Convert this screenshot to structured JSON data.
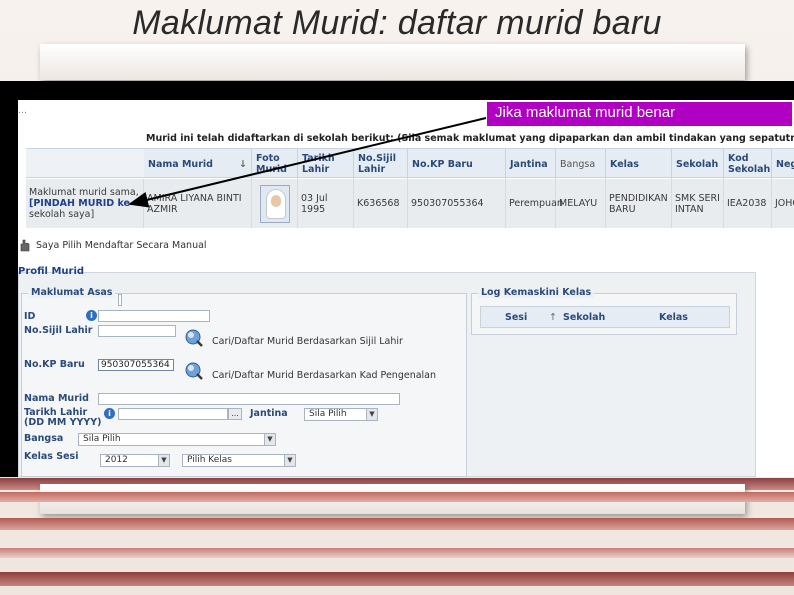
{
  "slide": {
    "title": "Maklumat Murid: daftar murid baru",
    "callout": "Jika maklumat murid benar"
  },
  "app": {
    "top_text": "…",
    "notice_lead": "Murid ini telah didaftarkan di sekolah berikut:",
    "notice_paren": "(Sila semak maklumat yang dipaparkan dan ambil tindakan yang sepatutnya)",
    "table": {
      "headers": [
        "Nama Murid",
        "Foto Murid",
        "Tarikh Lahir",
        "No.Sijil Lahir",
        "No.KP Baru",
        "Jantina",
        "Bangsa",
        "Kelas",
        "Sekolah",
        "Kod Sekolah",
        "Negeri"
      ],
      "row": {
        "note_prefix": "Maklumat murid sama,",
        "note_action": "[PINDAH MURID ke",
        "note_suffix": "sekolah saya]",
        "nama": "AMIRA LIYANA BINTI AZMIR",
        "tarikh_lahir": "03 Jul 1995",
        "sijil_lahir": "K636568",
        "kp_baru": "950307055364",
        "jantina": "Perempuan",
        "bangsa": "MELAYU",
        "kelas": "PENDIDIKAN BARU",
        "sekolah": "SMK SERI INTAN",
        "kod_sekolah": "IEA2038",
        "negeri": "JOHOR"
      }
    },
    "manual_label": "Saya Pilih Mendaftar Secara Manual",
    "profil_title": "Profil Murid",
    "maklumat_asas": {
      "legend": "Maklumat Asas",
      "id_label": "ID",
      "sijil_label": "No.Sijil Lahir",
      "kp_label": "No.KP Baru",
      "kp_value": "950307055364",
      "search_sijil": "Cari/Daftar Murid Berdasarkan Sijil Lahir",
      "search_kp": "Cari/Daftar Murid Berdasarkan Kad Pengenalan",
      "nama_label": "Nama Murid",
      "tarikh_label": "Tarikh Lahir",
      "tarikh_format": "(DD MM YYYY)",
      "dots_button": "...",
      "jantina_label": "Jantina",
      "jantina_value": "Sila Pilih",
      "bangsa_label": "Bangsa",
      "bangsa_value": "Sila Pilih",
      "kelas_sesi_label": "Kelas Sesi",
      "sesi_value": "2012",
      "kelas_value": "Pilih Kelas"
    },
    "log_kelas": {
      "legend": "Log Kemaskini Kelas",
      "headers": [
        "Sesi",
        "Sekolah",
        "Kelas"
      ]
    }
  },
  "colors": {
    "callout_bg": "#b000c2",
    "link_blue": "#1d3f8c",
    "header_bg": "#e6ecf3"
  },
  "icons": [
    "info-icon",
    "search-icon",
    "hand-icon",
    "sort-icon"
  ]
}
